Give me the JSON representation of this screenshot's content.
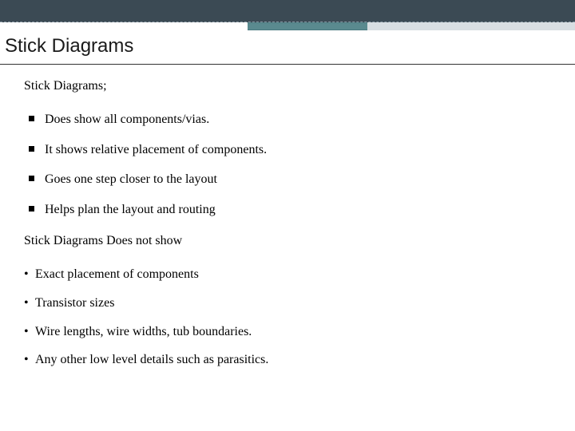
{
  "title": "Stick Diagrams",
  "intro": "Stick Diagrams;",
  "does_list": [
    "Does show all components/vias.",
    "It shows relative placement of components.",
    "Goes one step closer to the layout",
    "Helps plan the layout and routing"
  ],
  "not_header": "Stick Diagrams  Does not  show",
  "not_list": [
    "Exact placement of components",
    "Transistor sizes",
    "Wire lengths, wire widths, tub boundaries.",
    "Any other low level details such as parasitics."
  ]
}
